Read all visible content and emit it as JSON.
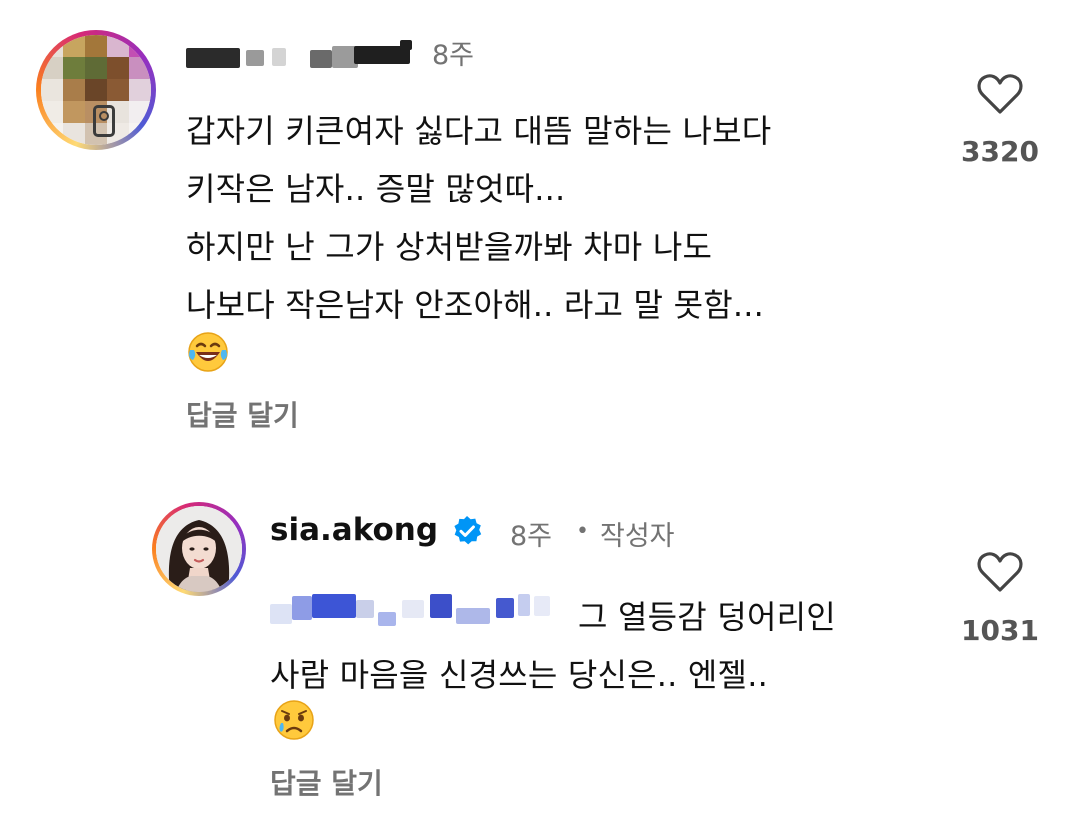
{
  "comments": [
    {
      "username": "",
      "time": "8주",
      "lines": [
        "갑자기 키큰여자 싫다고 대뜸 말하는 나보다",
        "키작은 남자.. 증말 많엇따...",
        "하지만 난 그가 상처받을까봐 차마 나도",
        "나보다 작은남자 안조아해.. 라고 말 못함..."
      ],
      "emoji": "laughing-tears-emoji",
      "reply_label": "답글 달기",
      "likes": "3320"
    },
    {
      "username": "sia.akong",
      "time": "8주",
      "separator": "•",
      "author_badge": "작성자",
      "mention_suffix": "그 열등감 덩어리인",
      "lines": [
        "사람 마음을 신경쓰는 당신은.. 엔젤.."
      ],
      "emoji": "crying-face-emoji",
      "reply_label": "답글 달기",
      "likes": "1031"
    }
  ],
  "colors": {
    "meta_gray": "#737373",
    "verified_blue": "#0095f6",
    "heart_outline": "#444444"
  },
  "icons": {
    "like": "heart-outline-icon",
    "verified": "verified-badge-icon"
  }
}
